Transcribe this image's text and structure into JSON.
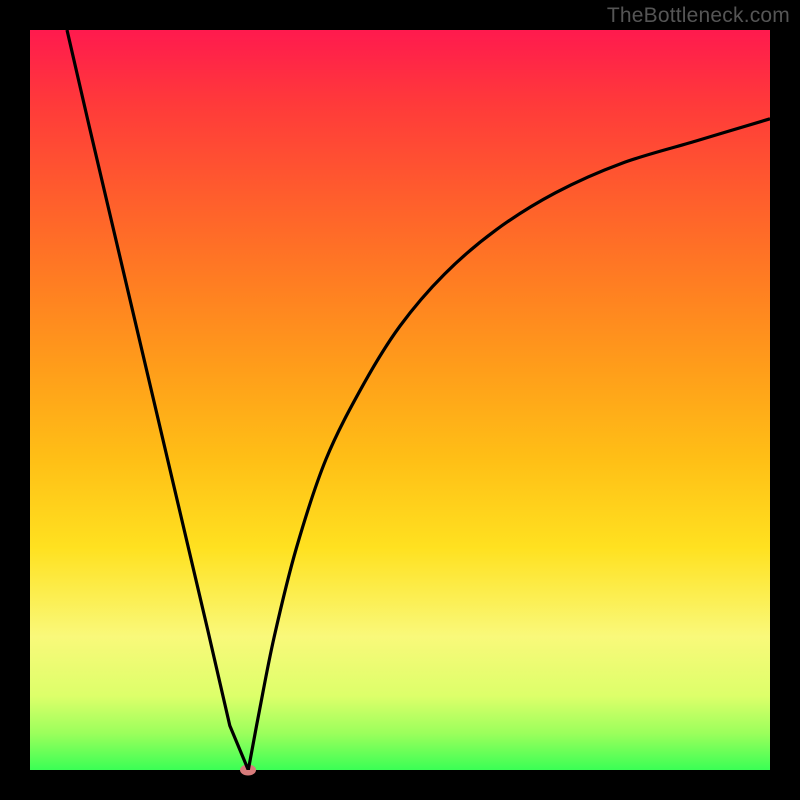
{
  "watermark": "TheBottleneck.com",
  "chart_data": {
    "type": "line",
    "title": "",
    "xlabel": "",
    "ylabel": "",
    "xlim": [
      0,
      100
    ],
    "ylim": [
      0,
      100
    ],
    "grid": false,
    "legend": false,
    "background": "red-yellow-green vertical gradient (high=red top, low=green bottom)",
    "series": [
      {
        "name": "left-branch",
        "x": [
          5,
          8,
          12,
          16,
          20,
          24,
          27,
          29.5
        ],
        "y": [
          100,
          87,
          70,
          53,
          36,
          19,
          6,
          0
        ]
      },
      {
        "name": "right-branch",
        "x": [
          29.5,
          31,
          33,
          36,
          40,
          45,
          50,
          56,
          63,
          71,
          80,
          90,
          100
        ],
        "y": [
          0,
          8,
          18,
          30,
          42,
          52,
          60,
          67,
          73,
          78,
          82,
          85,
          88
        ]
      }
    ],
    "annotations": [
      {
        "name": "minimum-marker",
        "x": 29.5,
        "y": 0,
        "shape": "ellipse",
        "color": "#d77b7b"
      }
    ]
  }
}
